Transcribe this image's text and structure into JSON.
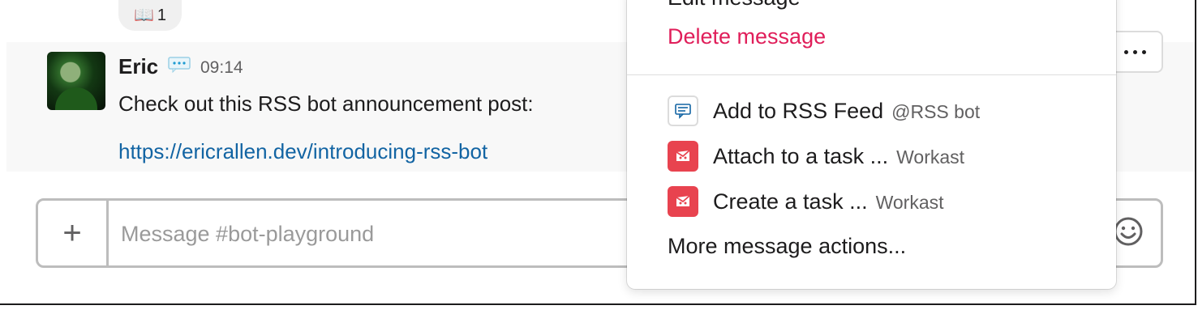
{
  "reaction": {
    "emoji": "📖",
    "count": "1"
  },
  "message": {
    "author": "Eric",
    "time": "09:14",
    "text": "Check out this RSS bot announcement post:",
    "link": "https://ericrallen.dev/introducing-rss-bot"
  },
  "composer": {
    "placeholder": "Message #bot-playground",
    "value": ""
  },
  "menu": {
    "cut_item": "Edit message",
    "delete_item": "Delete message",
    "actions": [
      {
        "label": "Add to RSS Feed",
        "app": "@RSS bot",
        "icon": "rss-bot-icon"
      },
      {
        "label": "Attach to a task ...",
        "app": "Workast",
        "icon": "workast-icon"
      },
      {
        "label": "Create a task ...",
        "app": "Workast",
        "icon": "workast-icon"
      }
    ],
    "more": "More message actions..."
  },
  "colors": {
    "delete": "#e01e5a",
    "link": "#1264a3",
    "workast": "#e8434f"
  }
}
